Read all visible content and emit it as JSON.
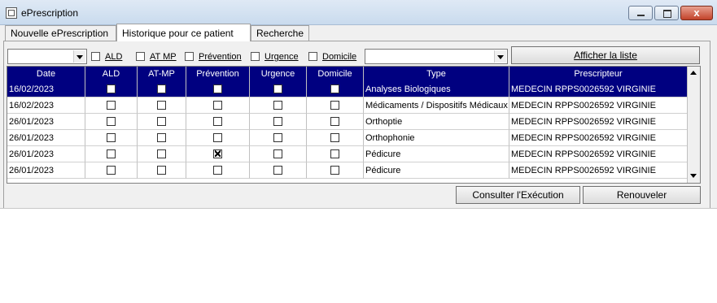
{
  "window": {
    "title": "ePrescription",
    "close_glyph": "x"
  },
  "tabs": [
    "Nouvelle ePrescription",
    "Historique pour ce patient",
    "Recherche"
  ],
  "filters": {
    "date_combo_value": "",
    "checkboxes": [
      "ALD",
      "AT MP",
      "Prévention",
      "Urgence",
      "Domicile"
    ],
    "type_combo_value": "",
    "show_list_button": "Afficher la liste"
  },
  "table": {
    "columns": [
      "Date",
      "ALD",
      "AT-MP",
      "Prévention",
      "Urgence",
      "Domicile",
      "Type",
      "Prescripteur"
    ],
    "rows": [
      {
        "date": "16/02/2023",
        "ald": false,
        "atmp": false,
        "prevention": false,
        "urgence": false,
        "domicile": false,
        "type": "Analyses Biologiques",
        "prescripteur": "MEDECIN RPPS0026592 VIRGINIE",
        "selected": true
      },
      {
        "date": "16/02/2023",
        "ald": false,
        "atmp": false,
        "prevention": false,
        "urgence": false,
        "domicile": false,
        "type": "Médicaments / Dispositifs Médicaux",
        "prescripteur": "MEDECIN RPPS0026592 VIRGINIE",
        "selected": false
      },
      {
        "date": "26/01/2023",
        "ald": false,
        "atmp": false,
        "prevention": false,
        "urgence": false,
        "domicile": false,
        "type": "Orthoptie",
        "prescripteur": "MEDECIN RPPS0026592 VIRGINIE",
        "selected": false
      },
      {
        "date": "26/01/2023",
        "ald": false,
        "atmp": false,
        "prevention": false,
        "urgence": false,
        "domicile": false,
        "type": "Orthophonie",
        "prescripteur": "MEDECIN RPPS0026592 VIRGINIE",
        "selected": false
      },
      {
        "date": "26/01/2023",
        "ald": false,
        "atmp": false,
        "prevention": true,
        "urgence": false,
        "domicile": false,
        "type": "Pédicure",
        "prescripteur": "MEDECIN RPPS0026592 VIRGINIE",
        "selected": false
      },
      {
        "date": "26/01/2023",
        "ald": false,
        "atmp": false,
        "prevention": false,
        "urgence": false,
        "domicile": false,
        "type": "Pédicure",
        "prescripteur": "MEDECIN RPPS0026592 VIRGINIE",
        "selected": false
      }
    ]
  },
  "actions": {
    "consult_label": "Consulter l'Exécution",
    "renew_label": "Renouveler"
  },
  "colors": {
    "header_bg": "#000080",
    "selection_bg": "#000080",
    "close_button": "#c2422a"
  }
}
